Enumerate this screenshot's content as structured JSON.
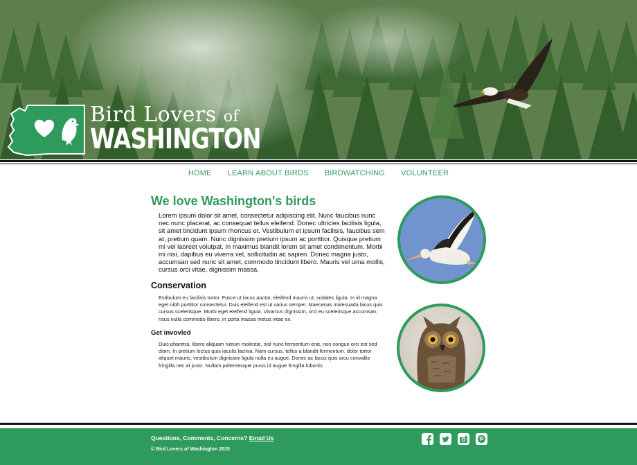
{
  "logo": {
    "line1": "Bird Lovers",
    "line1_of": "of",
    "line2": "WASHINGTON"
  },
  "nav": {
    "items": [
      "HOME",
      "LEARN ABOUT BIRDS",
      "BIRDWATCHING",
      "VOLUNTEER"
    ]
  },
  "main": {
    "heading": "We love Washington's birds",
    "intro": "Lorem ipsum dolor sit amet, consectetur adipiscing elit. Nunc faucibus nunc nec nunc placerat, ac consequat tellus eleifend. Donec ultricies facilisis ligula, sit amet tincidunt ipsum rhoncus et. Vestibulum et ipsum facilisis, faucibus sem at, pretium quam. Nunc dignissim pretium ipsum ac porttitor. Quisque pretium mi vel laoreet volutpat. In maximus blandit lorem sit amet condimentum. Morbi mi nisi, dapibus eu viverra vel, sollicitudin ac sapien. Donec magna justo, accumsan sed nunc sit amet, commodo tincidunt libero. Mauris vel urna mollis, cursus orci vitae, dignissim massa.",
    "conservation_heading": "Conservation",
    "conservation_text": "Estibulum eu facilisis tortor. Fusce ut lacus auctor, eleifend mauris ut, sodales ligula. In id magna eget nibh porttitor consectetur. Duis eleifend est ut varius semper. Maecenas malesuada lacus quis cursus scelerisque. Morbi eget eleifend ligula. Vivamus dignissim, orci eu scelerisque accumsan, risus nulla commodo libero, in porta massa metus vitae ex.",
    "involved_heading": "Get invovled",
    "involved_text": "Duis pharetra, libero aliquam rutrum molestie, nisl nunc fermentum erat, non congue orci est sed diam. In pretium lectus quis iaculis lacinia. Nam cursus, tellus a blandit fermentum, dolor tortor aliquet mauris, vestibulum dignissim ligula nulla eu augue. Donec ac lacus quis arcu convallis fringilla nec at justo. Nullam pellentesque purus id augue fringilla lobortis."
  },
  "footer": {
    "question": "Questions, Comments, Concerns?",
    "email_link": "Email Us",
    "copyright": "© Bird Lovers of Washington 2015",
    "social_icons": [
      "facebook-icon",
      "twitter-icon",
      "instagram-icon",
      "pinterest-icon"
    ]
  },
  "colors": {
    "accent": "#2e9a5c",
    "footer_bg": "#2e9a5c",
    "rule": "#111111"
  }
}
